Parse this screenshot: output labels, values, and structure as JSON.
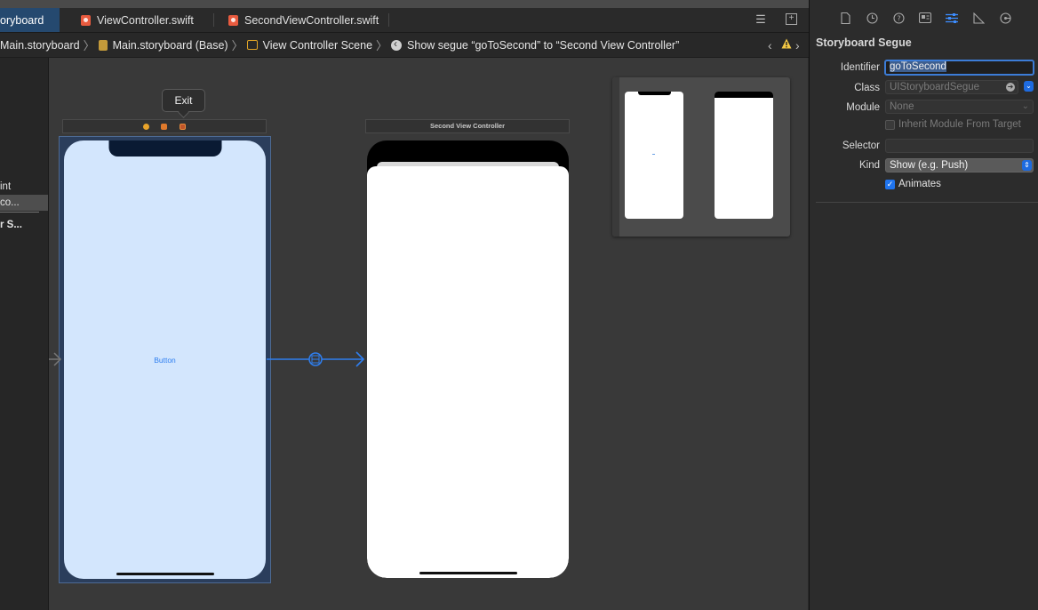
{
  "tabs": [
    {
      "label": "oryboard",
      "active": true
    },
    {
      "label": "ViewController.swift",
      "active": false
    },
    {
      "label": "SecondViewController.swift",
      "active": false
    }
  ],
  "breadcrumbs": [
    {
      "label": "Main.storyboard",
      "icon": "none"
    },
    {
      "label": "Main.storyboard (Base)",
      "icon": "storyboard-file-icon"
    },
    {
      "label": "View Controller Scene",
      "icon": "scene-icon"
    },
    {
      "label": "Show segue “goToSecond” to “Second View Controller”",
      "icon": "segue-icon"
    }
  ],
  "outline": {
    "items": [
      "int",
      "co...",
      "r S..."
    ]
  },
  "canvas": {
    "exit_tooltip": "Exit",
    "button_label": "Button",
    "second_scene_title": "Second View Controller"
  },
  "inspector": {
    "title": "Storyboard Segue",
    "identifier_label": "Identifier",
    "identifier_value": "goToSecond",
    "class_label": "Class",
    "class_placeholder": "UIStoryboardSegue",
    "module_label": "Module",
    "module_placeholder": "None",
    "inherit_label": "Inherit Module From Target",
    "inherit_checked": false,
    "selector_label": "Selector",
    "selector_value": "",
    "kind_label": "Kind",
    "kind_value": "Show (e.g. Push)",
    "animates_label": "Animates",
    "animates_checked": true
  },
  "colors": {
    "accent": "#1f74ee",
    "segue_line": "#2f7ff0",
    "first_view_bg": "#d3e6fd",
    "warning": "#f2c744"
  }
}
